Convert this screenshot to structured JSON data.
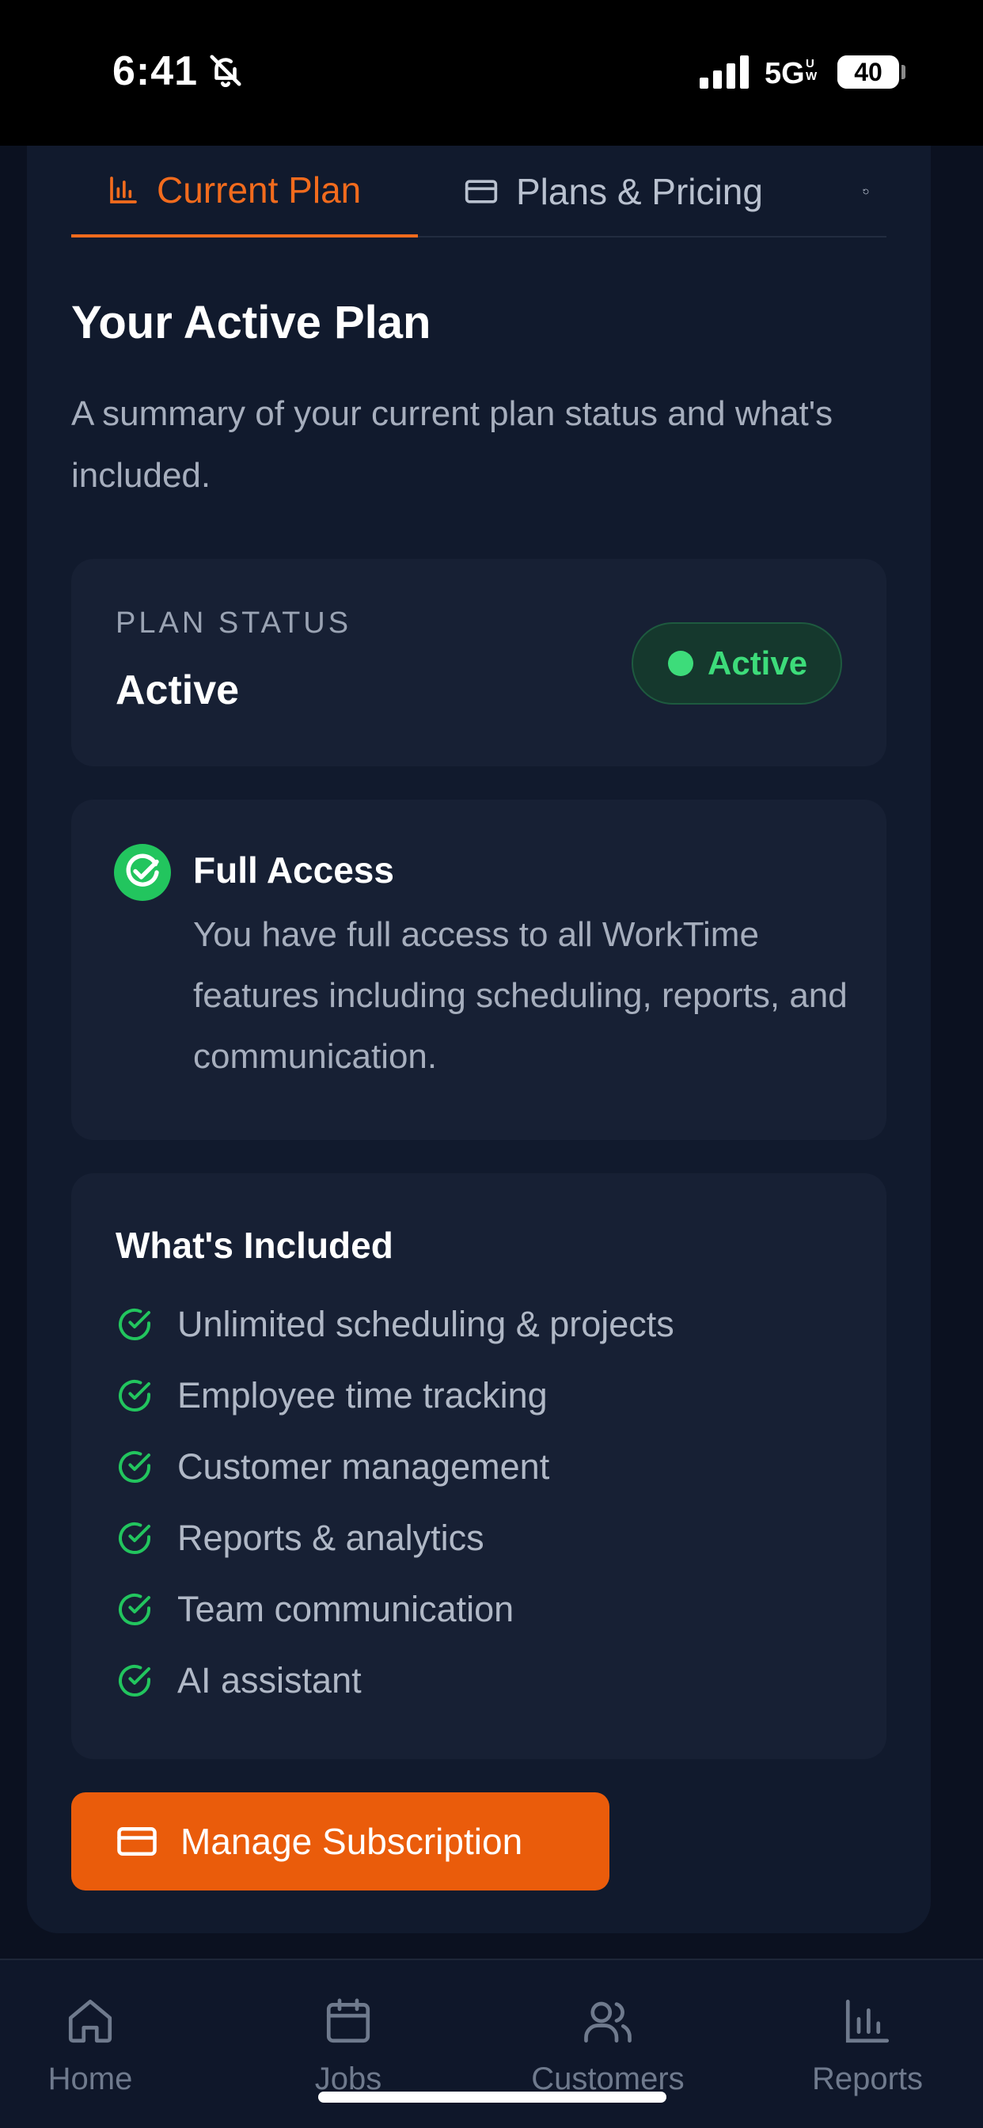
{
  "status_bar": {
    "time": "6:41",
    "network": "5G",
    "network_sub": "UW",
    "battery": "40",
    "battery_fraction": 0.4
  },
  "tabs": [
    {
      "label": "Current Plan",
      "icon": "bar-chart-icon",
      "active": true
    },
    {
      "label": "Plans & Pricing",
      "icon": "credit-card-icon",
      "active": false
    },
    {
      "label": "",
      "icon": "history-icon",
      "active": false
    }
  ],
  "header": {
    "title": "Your Active Plan",
    "subtitle": "A summary of your current plan status and what's included."
  },
  "plan_status": {
    "label": "PLAN STATUS",
    "value": "Active",
    "badge": "Active"
  },
  "access": {
    "title": "Full Access",
    "description": "You have full access to all WorkTime features including scheduling, reports, and communication."
  },
  "included": {
    "title": "What's Included",
    "items": [
      "Unlimited scheduling & projects",
      "Employee time tracking",
      "Customer management",
      "Reports & analytics",
      "Team communication",
      "AI assistant"
    ]
  },
  "actions": {
    "manage_label": "Manage Subscription"
  },
  "nav": [
    {
      "label": "Home",
      "icon": "home-icon"
    },
    {
      "label": "Jobs",
      "icon": "calendar-icon"
    },
    {
      "label": "Customers",
      "icon": "users-icon"
    },
    {
      "label": "Reports",
      "icon": "bar-chart-icon"
    }
  ],
  "colors": {
    "accent": "#ea5c0b",
    "success": "#3ddc7a",
    "background": "#0b1120",
    "card": "#111a2d",
    "panel": "#172034"
  }
}
